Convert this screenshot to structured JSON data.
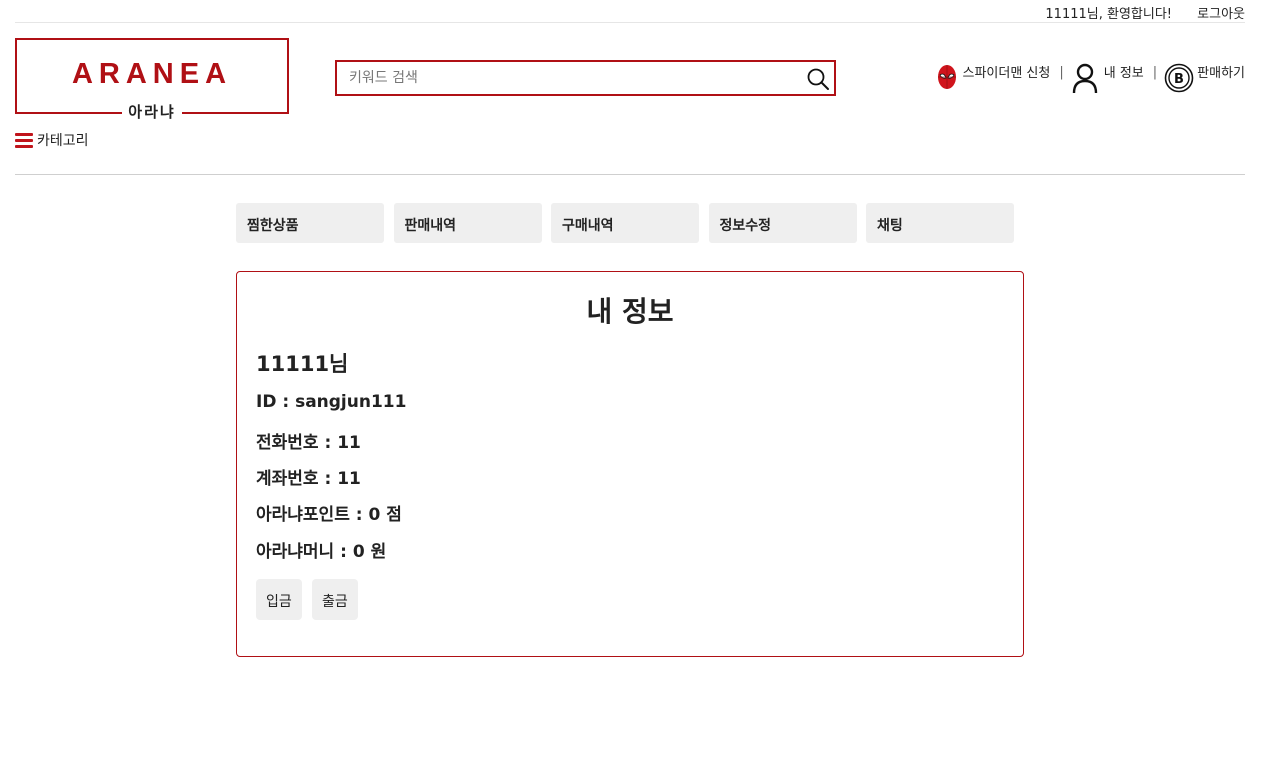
{
  "topbar": {
    "welcome": "11111님, 환영합니다!",
    "logout": "로그아웃"
  },
  "logo": {
    "main": "ARANEA",
    "sub": "아라냐"
  },
  "category": {
    "label": "카테고리"
  },
  "search": {
    "placeholder": "키워드 검색",
    "value": ""
  },
  "usernav": {
    "spiderman": "스파이더맨 신청",
    "myinfo": "내 정보",
    "sell": "판매하기"
  },
  "tabs": [
    "찜한상품",
    "판매내역",
    "구매내역",
    "정보수정",
    "채팅"
  ],
  "info": {
    "title": "내 정보",
    "user_name": "11111님",
    "id_row": "ID : sangjun111",
    "phone_row": "전화번호 : 11",
    "account_row": "계좌번호 : 11",
    "point_row": "아라냐포인트 : 0 점",
    "money_row": "아라냐머니 : 0 원"
  },
  "actions": {
    "deposit": "입금",
    "withdraw": "출금"
  },
  "colors": {
    "brand": "#b01015",
    "tab_bg": "#efefef"
  },
  "icons": [
    "search-icon",
    "menu-icon",
    "spiderman-icon",
    "user-icon",
    "coin-icon"
  ]
}
